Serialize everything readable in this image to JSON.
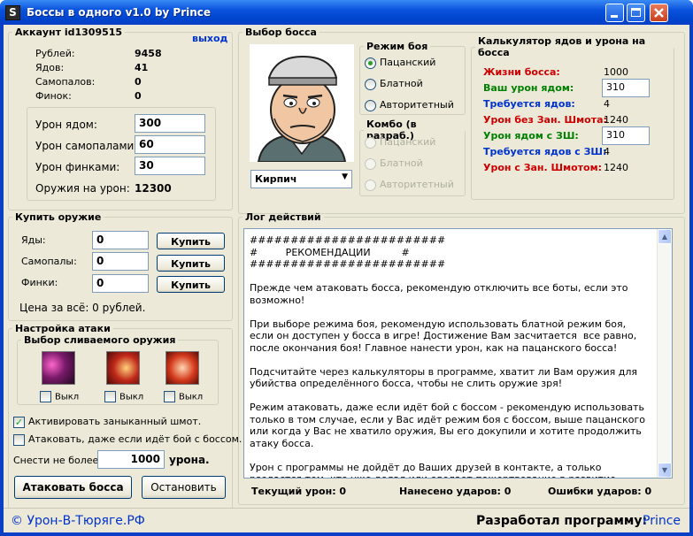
{
  "window": {
    "title": "Боссы в одного v1.0 by Prince",
    "app_icon_glyph": "S"
  },
  "account": {
    "legend": "Аккаунт id1309515",
    "logout_link": "выход",
    "stats": [
      {
        "label": "Рублей:",
        "value": "9458"
      },
      {
        "label": "Ядов:",
        "value": "41"
      },
      {
        "label": "Самопалов:",
        "value": "0"
      },
      {
        "label": "Финок:",
        "value": "0"
      }
    ],
    "damage": {
      "poison_label": "Урон ядом:",
      "poison_value": "300",
      "samopal_label": "Урон самопалами:",
      "samopal_value": "60",
      "finka_label": "Урон финками:",
      "finka_value": "30",
      "weapons_label": "Оружия на урон:",
      "weapons_value": "12300"
    }
  },
  "boss": {
    "legend": "Выбор босса",
    "selected": "Кирпич",
    "mode": {
      "legend": "Режим боя",
      "options": [
        "Пацанский",
        "Блатной",
        "Авторитетный"
      ],
      "selected_index": 0
    },
    "combo": {
      "legend": "Комбо (в разраб.)",
      "options": [
        "Пацанский",
        "Блатной",
        "Авторитетный"
      ]
    }
  },
  "calc": {
    "legend": "Калькулятор ядов и урона на босса",
    "rows": [
      {
        "label": "Жизни босса:",
        "value": "1000",
        "color": "red",
        "input": false
      },
      {
        "label": "Ваш урон ядом:",
        "value": "310",
        "color": "green",
        "input": true
      },
      {
        "label": "Требуется ядов:",
        "value": "4",
        "color": "blue",
        "input": false
      },
      {
        "label": "Урон без Зан. Шмота:",
        "value": "1240",
        "color": "red",
        "input": false
      },
      {
        "label": "Урон ядом с ЗШ:",
        "value": "310",
        "color": "green",
        "input": true
      },
      {
        "label": "Требуется ядов с ЗШ:",
        "value": "4",
        "color": "blue",
        "input": false
      },
      {
        "label": "Урон с Зан. Шмотом:",
        "value": "1240",
        "color": "red",
        "input": false
      }
    ]
  },
  "buy": {
    "legend": "Купить оружие",
    "items": [
      {
        "label": "Яды:",
        "value": "0",
        "button": "Купить"
      },
      {
        "label": "Самопалы:",
        "value": "0",
        "button": "Купить"
      },
      {
        "label": "Финки:",
        "value": "0",
        "button": "Купить"
      }
    ],
    "total": "Цена за всё: 0 рублей."
  },
  "attack": {
    "legend": "Настройка атаки",
    "drain_legend": "Выбор сливаемого оружия",
    "off_label": "Выкл",
    "tiles": [
      "poison-icon",
      "samopal-icon",
      "finka-icon"
    ],
    "activate_label": "Активировать заныканный шмот.",
    "activate_checked": true,
    "attack_busy_label": "Атаковать, даже если идёт бой с боссом.",
    "attack_busy_checked": false,
    "max_label": "Снести не более:",
    "max_value": "1000",
    "max_unit": "урона.",
    "attack_button": "Атаковать босса",
    "stop_button": "Остановить"
  },
  "log": {
    "legend": "Лог действий",
    "text": "########################\n#         РЕКОМЕНДАЦИИ          #\n########################\n\nПрежде чем атаковать босса, рекомендую отключить все боты, если это возможно!\n\nПри выборе режима боя, рекомендую использовать блатной режим боя, если он доступен у босса в игре! Достижение Вам засчитается  все равно, после окончания боя! Главное нанести урон, как на пацанского босса!\n\nПодсчитайте через калькуляторы в программе, хватит ли Вам оружия для убийства определённого босса, чтобы не слить оружие зря!\n\nРежим атаковать, даже если идёт бой с боссом - рекомендую использовать только в том случае, если у Вас идёт режим боя с боссом, выше пацанского или когда у Вас не хватило оружия, Вы его докупили и хотите продолжить атаку босса.\n\nУрон с программы не дойдёт до Ваших друзей в контакте, а только раздастся тем, кто уже делал или сделает пожертвование в развитие Клиента для Тюряги by Prince.",
    "current_damage": "Текущий урон: 0",
    "hits": "Нанесено ударов: 0",
    "errors": "Ошибки ударов: 0"
  },
  "footer": {
    "site": "© Урон-В-Тюряге.РФ",
    "author_label": "Разработал программу:",
    "author_name": "Prince"
  }
}
